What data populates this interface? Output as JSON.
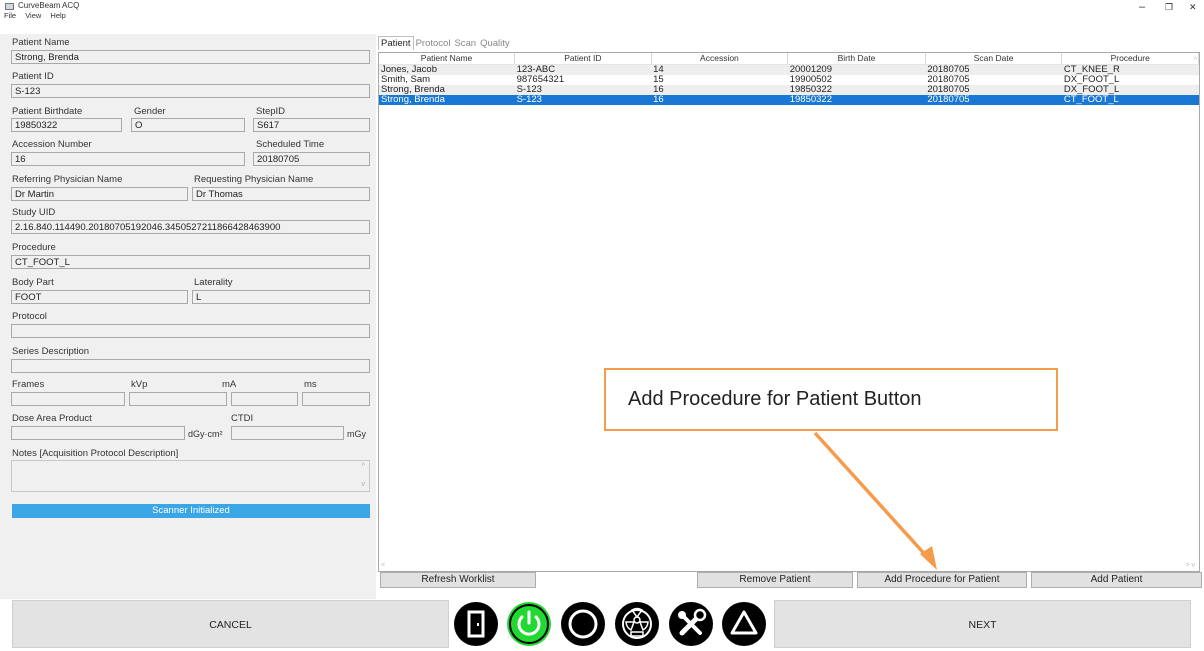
{
  "window": {
    "title": "CurveBeam ACQ",
    "minimize_glyph": "–",
    "maximize_glyph": "❐",
    "close_glyph": "✕"
  },
  "menu": {
    "items": [
      "File",
      "View",
      "Help"
    ]
  },
  "form": {
    "patient_name_label": "Patient Name",
    "patient_name": "Strong, Brenda",
    "patient_id_label": "Patient ID",
    "patient_id": "S-123",
    "birthdate_label": "Patient Birthdate",
    "birthdate": "19850322",
    "gender_label": "Gender",
    "gender": "O",
    "stepid_label": "StepID",
    "stepid": "S617",
    "accession_label": "Accession Number",
    "accession": "16",
    "scheduled_label": "Scheduled Time",
    "scheduled": "20180705",
    "referring_label": "Referring Physician Name",
    "referring": "Dr Martin",
    "requesting_label": "Requesting Physician Name",
    "requesting": "Dr Thomas",
    "study_uid_label": "Study UID",
    "study_uid": "2.16.840.114490.20180705192046.3450527211866428463900",
    "procedure_label": "Procedure",
    "procedure": "CT_FOOT_L",
    "body_part_label": "Body Part",
    "body_part": "FOOT",
    "laterality_label": "Laterality",
    "laterality": "L",
    "protocol_label": "Protocol",
    "protocol": "",
    "series_label": "Series Description",
    "series": "",
    "frames_label": "Frames",
    "kvp_label": "kVp",
    "ma_label": "mA",
    "ms_label": "ms",
    "dap_label": "Dose Area Product",
    "dap_unit": "dGy·cm²",
    "ctdi_label": "CTDI",
    "ctdi_unit": "mGy",
    "notes_label": "Notes [Acquisition Protocol Description]",
    "status": "Scanner Initialized"
  },
  "tabs": [
    "Patient",
    "Protocol",
    "Scan",
    "Quality"
  ],
  "table": {
    "columns": [
      "Patient Name",
      "Patient ID",
      "Accession",
      "Birth Date",
      "Scan Date",
      "Procedure"
    ],
    "rows": [
      [
        "Jones, Jacob",
        "123-ABC",
        "14",
        "20001209",
        "20180705",
        "CT_KNEE_R"
      ],
      [
        "Smith, Sam",
        "987654321",
        "15",
        "19900502",
        "20180705",
        "DX_FOOT_L"
      ],
      [
        "Strong, Brenda",
        "S-123",
        "16",
        "19850322",
        "20180705",
        "DX_FOOT_L"
      ],
      [
        "Strong, Brenda",
        "S-123",
        "16",
        "19850322",
        "20180705",
        "CT_FOOT_L"
      ]
    ],
    "selected_row": 3
  },
  "buttons": {
    "refresh": "Refresh Worklist",
    "remove": "Remove Patient",
    "add_procedure": "Add Procedure for Patient",
    "add_patient": "Add Patient",
    "cancel": "CANCEL",
    "next": "NEXT"
  },
  "annotation": {
    "callout": "Add Procedure for Patient Button"
  },
  "colors": {
    "accent": "#1978d4",
    "status_bar": "#3ba6e6",
    "power_active": "#22d933",
    "callout_border": "#f59b4c"
  },
  "icons": [
    "door-icon",
    "power-icon",
    "circle-icon",
    "radiation-icon",
    "tools-icon",
    "warning-triangle-icon"
  ]
}
